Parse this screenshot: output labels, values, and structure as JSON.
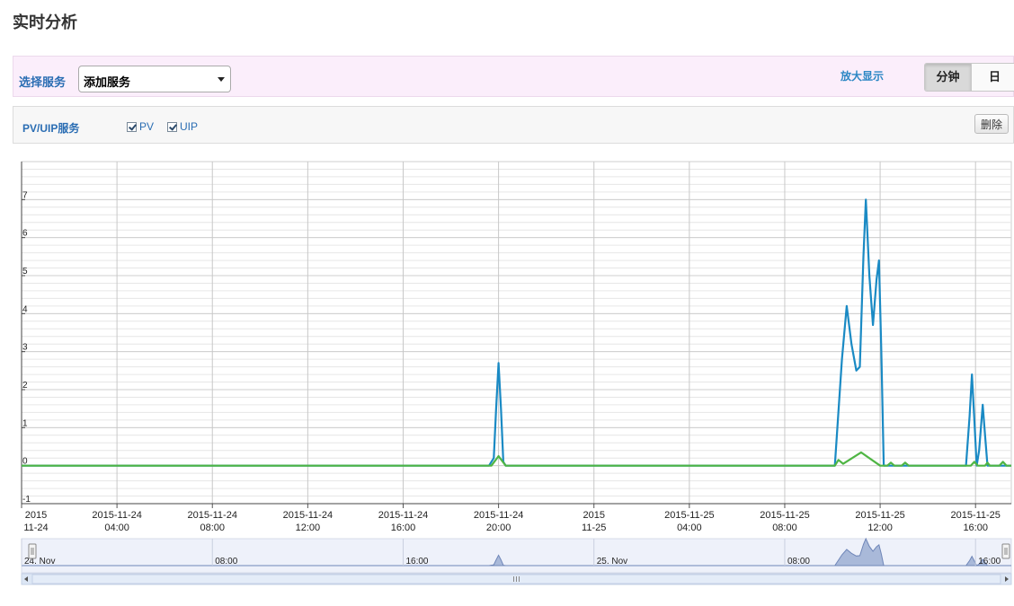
{
  "page": {
    "title": "实时分析"
  },
  "service_bar": {
    "label": "选择服务",
    "select_value": "添加服务",
    "zoom_link": "放大显示",
    "granularity": [
      {
        "label": "分钟",
        "active": true
      },
      {
        "label": "日",
        "active": false
      }
    ]
  },
  "pv_panel": {
    "title": "PV/UIP服务",
    "checkboxes": [
      {
        "label": "PV",
        "checked": true
      },
      {
        "label": "UIP",
        "checked": true
      }
    ],
    "delete_label": "删除"
  },
  "colors": {
    "pv": "#1a8ac4",
    "uip": "#4fb544",
    "navigator_fill": "#a9b9d9"
  },
  "chart_data": {
    "type": "line",
    "x_unit": "hours from 2015-11-24 00:00",
    "xlim": [
      0,
      17.5
    ],
    "ylim": [
      -1,
      8
    ],
    "y_ticks": [
      "-1",
      "0",
      "1",
      "2",
      "3",
      "4",
      "5",
      "6",
      "7"
    ],
    "x_ticks": [
      {
        "x": 0,
        "line1": "2015",
        "line2": "11-24"
      },
      {
        "x": 4,
        "line1": "2015-11-24",
        "line2": "04:00"
      },
      {
        "x": 8,
        "line1": "2015-11-24",
        "line2": "08:00"
      },
      {
        "x": 12,
        "line1": "2015-11-24",
        "line2": "12:00"
      },
      {
        "x": 16,
        "line1": "2015-11-24",
        "line2": "16:00"
      },
      {
        "x": 20,
        "line1": "2015-11-24",
        "line2": "20:00"
      },
      {
        "x": 24,
        "line1": "2015",
        "line2": "11-25"
      },
      {
        "x": 28,
        "line1": "2015-11-25",
        "line2": "04:00"
      },
      {
        "x": 32,
        "line1": "2015-11-25",
        "line2": "08:00"
      },
      {
        "x": 36,
        "line1": "2015-11-25",
        "line2": "12:00"
      },
      {
        "x": 40,
        "line1": "2015-11-25",
        "line2": "16:00"
      }
    ],
    "series": [
      {
        "name": "PV",
        "points": [
          [
            0,
            0
          ],
          [
            19.6,
            0
          ],
          [
            19.8,
            0.2
          ],
          [
            19.9,
            1.5
          ],
          [
            20.0,
            2.7
          ],
          [
            20.1,
            1.5
          ],
          [
            20.2,
            0.1
          ],
          [
            20.3,
            0
          ],
          [
            34.1,
            0
          ],
          [
            34.4,
            2.8
          ],
          [
            34.6,
            4.2
          ],
          [
            34.8,
            3.2
          ],
          [
            35.0,
            2.5
          ],
          [
            35.15,
            2.6
          ],
          [
            35.3,
            5.5
          ],
          [
            35.4,
            7.0
          ],
          [
            35.55,
            5.0
          ],
          [
            35.7,
            3.7
          ],
          [
            35.85,
            4.9
          ],
          [
            35.95,
            5.4
          ],
          [
            36.05,
            3.0
          ],
          [
            36.15,
            0
          ],
          [
            39.6,
            0
          ],
          [
            39.75,
            1.3
          ],
          [
            39.85,
            2.4
          ],
          [
            39.95,
            1.2
          ],
          [
            40.05,
            0
          ],
          [
            40.15,
            0.4
          ],
          [
            40.3,
            1.6
          ],
          [
            40.4,
            0.8
          ],
          [
            40.5,
            0
          ],
          [
            41.5,
            0
          ]
        ]
      },
      {
        "name": "UIP",
        "points": [
          [
            0,
            0
          ],
          [
            19.7,
            0
          ],
          [
            20.0,
            0.25
          ],
          [
            20.3,
            0
          ],
          [
            34.1,
            0
          ],
          [
            34.25,
            0.15
          ],
          [
            34.45,
            0.05
          ],
          [
            35.2,
            0.35
          ],
          [
            36.0,
            0
          ],
          [
            36.3,
            0
          ],
          [
            36.45,
            0.08
          ],
          [
            36.6,
            0
          ],
          [
            36.9,
            0
          ],
          [
            37.05,
            0.08
          ],
          [
            37.2,
            0
          ],
          [
            39.8,
            0
          ],
          [
            39.95,
            0.1
          ],
          [
            40.1,
            0
          ],
          [
            40.4,
            0
          ],
          [
            40.5,
            0.08
          ],
          [
            40.6,
            0
          ],
          [
            41.0,
            0
          ],
          [
            41.15,
            0.1
          ],
          [
            41.3,
            0
          ],
          [
            41.5,
            0
          ]
        ]
      }
    ],
    "navigator": {
      "labels": [
        {
          "x": 0,
          "text": "24. Nov"
        },
        {
          "x": 8,
          "text": "08:00"
        },
        {
          "x": 16,
          "text": "16:00"
        },
        {
          "x": 24,
          "text": "25. Nov"
        },
        {
          "x": 32,
          "text": "08:00"
        },
        {
          "x": 40,
          "text": "16:00"
        }
      ]
    }
  }
}
